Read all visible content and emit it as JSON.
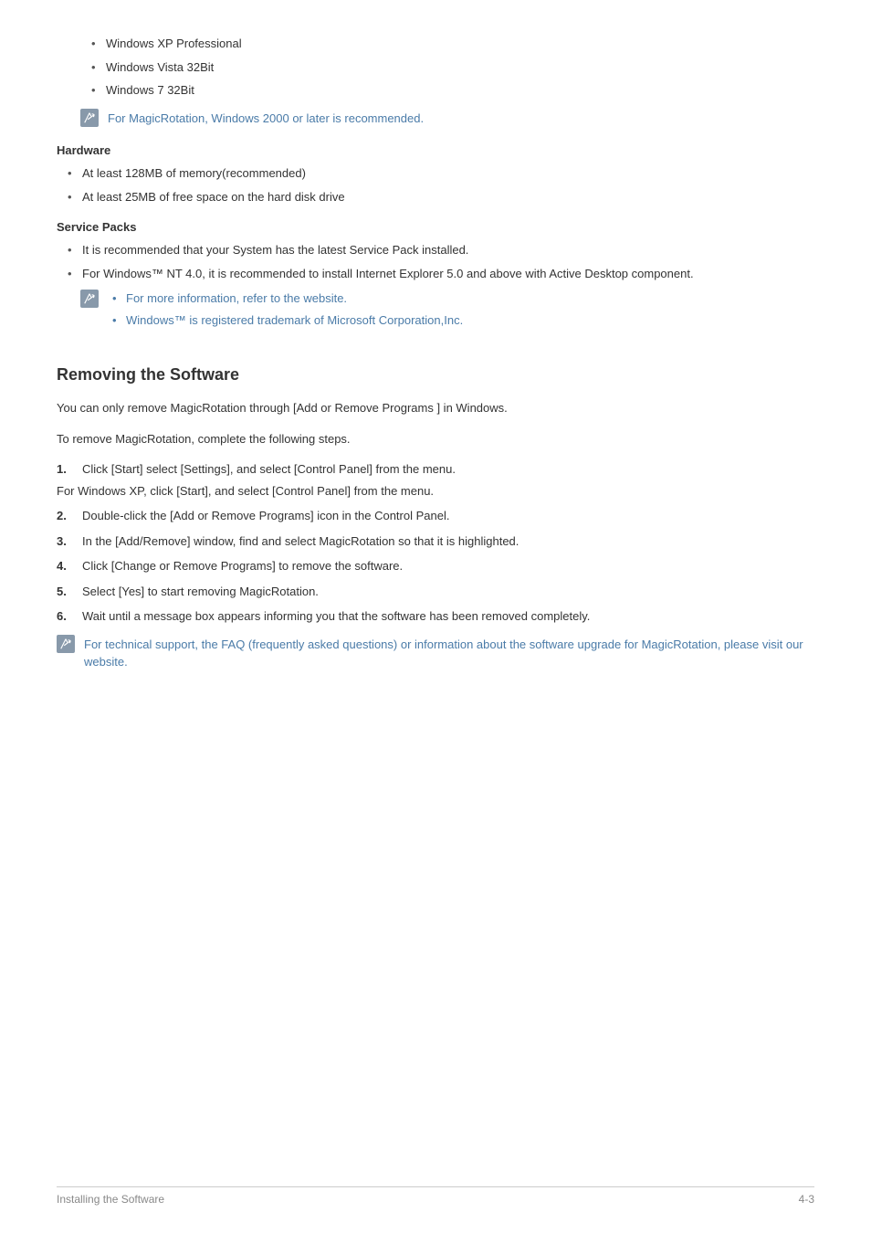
{
  "os_list": {
    "items": [
      "Windows XP Professional",
      "Windows Vista 32Bit",
      "Windows 7 32Bit"
    ]
  },
  "note1": "For MagicRotation, Windows 2000 or later is recommended.",
  "hardware": {
    "heading": "Hardware",
    "items": [
      "At least 128MB of memory(recommended)",
      "At least 25MB of free space on the hard disk drive"
    ]
  },
  "service_packs": {
    "heading": "Service Packs",
    "items": [
      "It is recommended that your System has the latest Service Pack installed.",
      "For Windows™ NT 4.0, it is recommended to install Internet Explorer 5.0 and above with Active Desktop component."
    ],
    "note_items": [
      "For more information, refer to the website.",
      "Windows™ is registered trademark of Microsoft Corporation,Inc."
    ]
  },
  "removing": {
    "heading": "Removing the Software",
    "intro1": "You can only remove MagicRotation through [Add or Remove Programs ] in Windows.",
    "intro2": "To remove MagicRotation, complete the following steps.",
    "steps": [
      "Click [Start] select [Settings], and select [Control Panel] from the menu.",
      "Double-click the [Add or Remove Programs] icon in the Control Panel.",
      "In the [Add/Remove] window, find and select MagicRotation so that it is highlighted.",
      "Click [Change or Remove Programs] to remove the software.",
      "Select [Yes] to start removing MagicRotation.",
      "Wait until a message box appears informing you that the software has been removed completely."
    ],
    "xp_line": "For Windows XP, click [Start], and select [Control Panel] from the menu.",
    "note": "For technical support, the FAQ (frequently asked questions) or information about the software upgrade for MagicRotation, please visit our website."
  },
  "footer": {
    "left": "Installing the Software",
    "right": "4-3"
  }
}
